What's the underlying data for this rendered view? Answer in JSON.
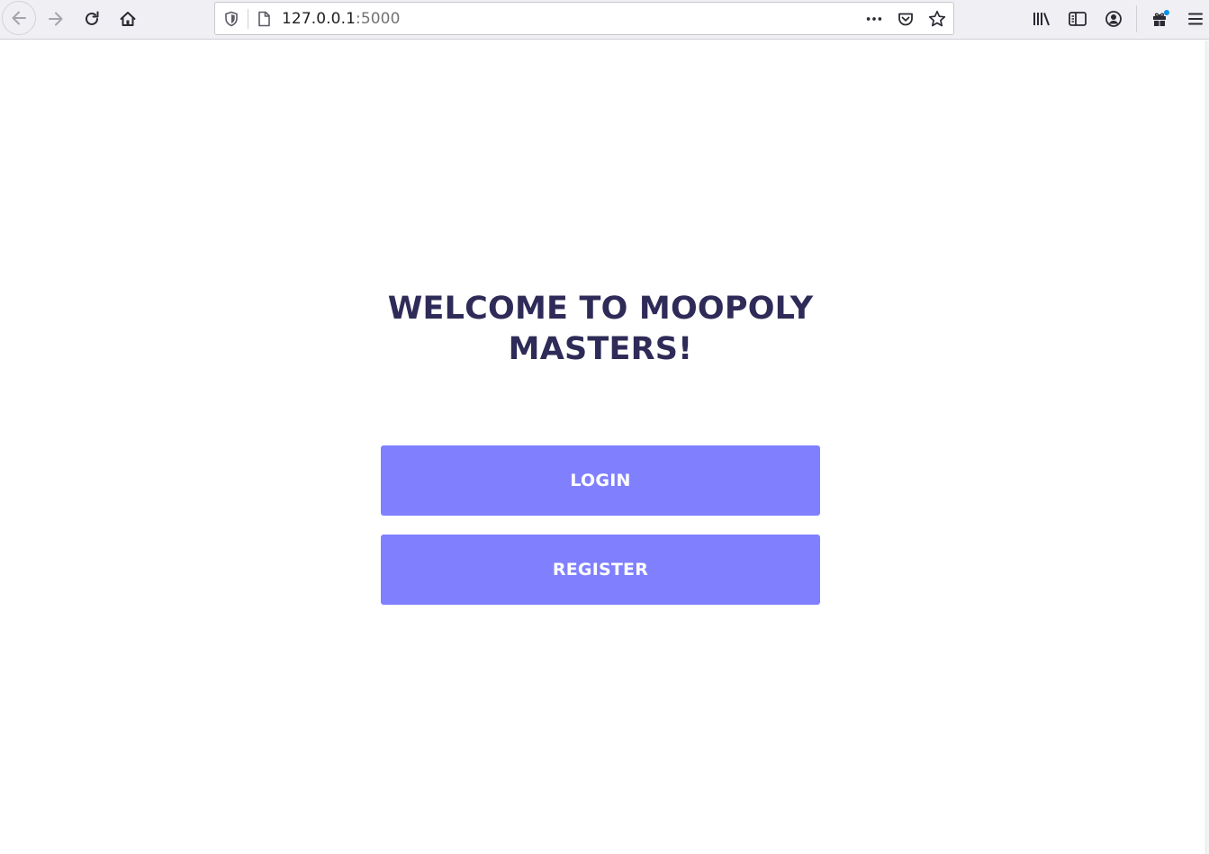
{
  "browser": {
    "url_host": "127.0.0.1",
    "url_port": ":5000",
    "icons": {
      "back": "back-arrow-icon",
      "forward": "forward-arrow-icon",
      "reload": "reload-icon",
      "home": "home-icon",
      "tracking": "shield-icon",
      "page": "page-icon",
      "actions": "more-dots-icon",
      "pocket": "pocket-icon",
      "bookmark": "star-icon",
      "library": "library-icon",
      "sidebar": "sidebar-icon",
      "account": "account-icon",
      "extensions": "gift-icon",
      "menu": "hamburger-menu-icon"
    },
    "colors": {
      "toolbar": "#f0f0f4",
      "notification_dot": "#0090ed"
    }
  },
  "page": {
    "heading": "WELCOME TO MOOPOLY MASTERS!",
    "login_label": "LOGIN",
    "register_label": "REGISTER",
    "colors": {
      "heading": "#2f2b58",
      "button": "#8080ff",
      "button_text": "#ffffff"
    }
  }
}
